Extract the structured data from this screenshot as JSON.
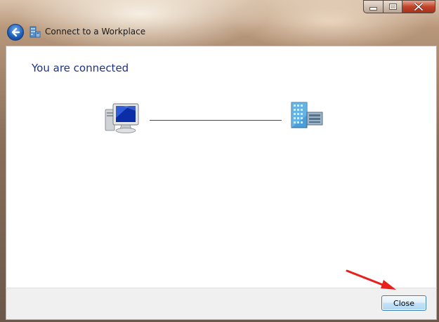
{
  "window": {
    "title": "Connect to a Workplace",
    "controls": [
      "minimize",
      "maximize",
      "close"
    ]
  },
  "content": {
    "heading": "You are connected",
    "diagram": {
      "left_icon": "computer-icon",
      "right_icon": "workplace-server-icon"
    }
  },
  "footer": {
    "close_label": "Close"
  },
  "annotation": {
    "arrow_color": "#e8201b",
    "points_to": "close-button"
  },
  "colors": {
    "heading": "#1e3287",
    "content_bg": "#ffffff",
    "footer_bg": "#f0f0f0"
  }
}
